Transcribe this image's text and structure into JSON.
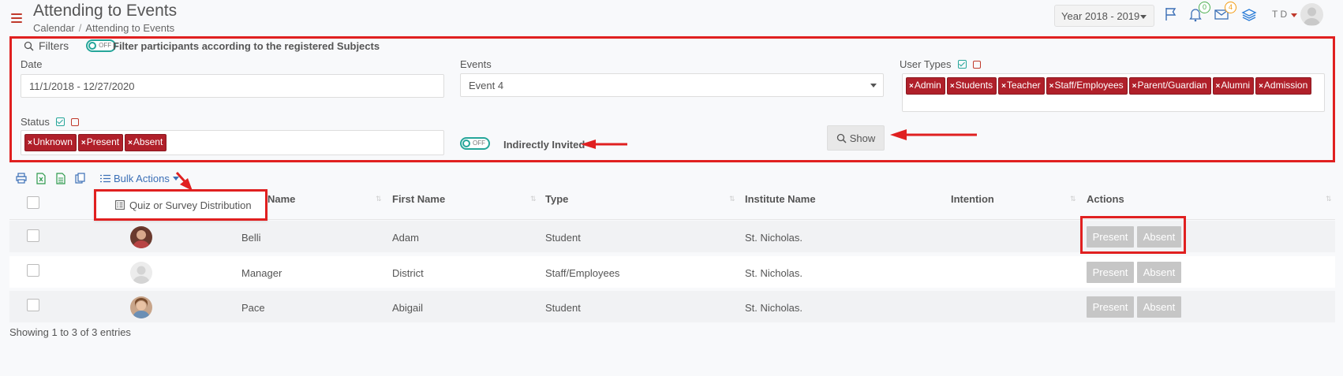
{
  "header": {
    "title": "Attending to Events",
    "breadcrumb": [
      "Calendar",
      "Attending to Events"
    ],
    "year_select": "Year 2018 - 2019",
    "notifications_count": "0",
    "messages_count": "4",
    "user_initials": "T D"
  },
  "filters": {
    "legend": "Filters",
    "toggle_off": "OFF",
    "subject_filter_label": "Filter participants according to the registered Subjects",
    "date_label": "Date",
    "date_value": "11/1/2018 - 12/27/2020",
    "events_label": "Events",
    "events_value": "Event 4",
    "user_types_label": "User Types",
    "user_types": [
      "Admin",
      "Students",
      "Teacher",
      "Staff/Employees",
      "Parent/Guardian",
      "Alumni",
      "Admission"
    ],
    "status_label": "Status",
    "statuses": [
      "Unknown",
      "Present",
      "Absent"
    ],
    "indirect_label": "Indirectly Invited",
    "show_button": "Show"
  },
  "toolbar": {
    "bulk_actions": "Bulk Actions",
    "dropdown_item": "Quiz or Survey Distribution"
  },
  "table": {
    "columns": [
      "Last Name",
      "First Name",
      "Type",
      "Institute Name",
      "Intention",
      "Actions"
    ],
    "column_last_name_visible": "Name",
    "rows": [
      {
        "last": "Belli",
        "first": "Adam",
        "type": "Student",
        "institute": "St. Nicholas.",
        "intention": ""
      },
      {
        "last": "Manager",
        "first": "District",
        "type": "Staff/Employees",
        "institute": "St. Nicholas.",
        "intention": ""
      },
      {
        "last": "Pace",
        "first": "Abigail",
        "type": "Student",
        "institute": "St. Nicholas.",
        "intention": ""
      }
    ],
    "present_label": "Present",
    "absent_label": "Absent",
    "info": "Showing 1 to 3 of 3 entries"
  },
  "colors": {
    "accent_red": "#b0202a",
    "toggle_teal": "#26a69a",
    "annotation_red": "#e02020"
  }
}
